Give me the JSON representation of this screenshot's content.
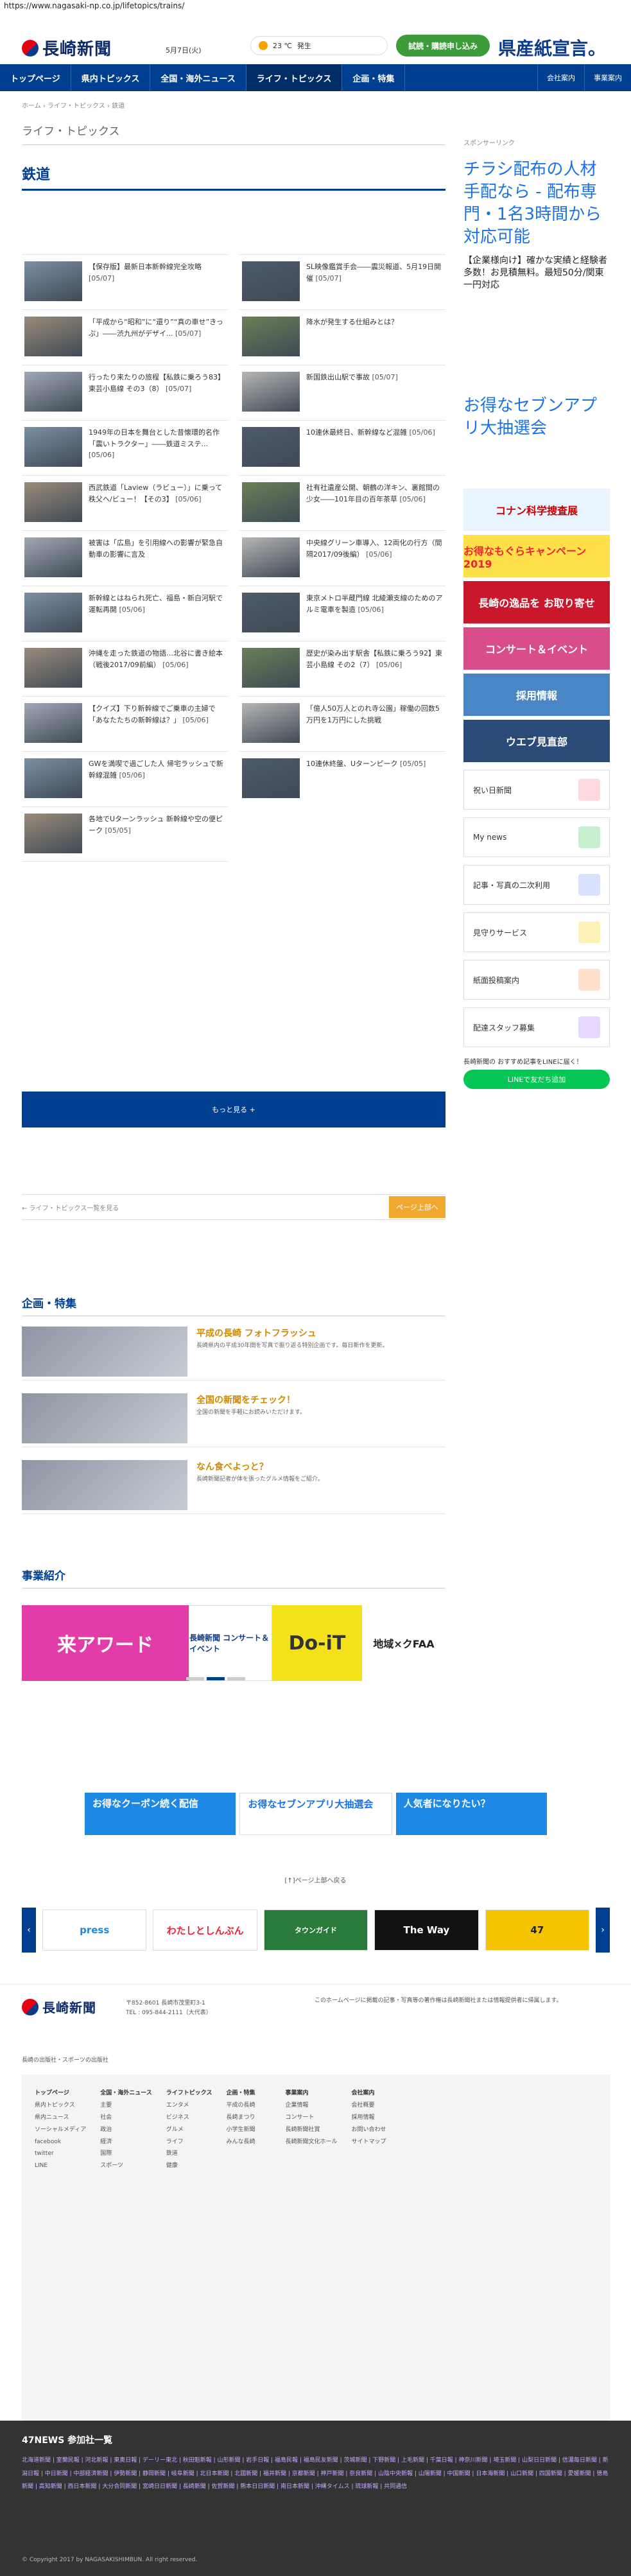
{
  "url": "https://www.nagasaki-np.co.jp/lifetopics/trains/",
  "header": {
    "logo_text": "長崎新聞",
    "date": "5月7日(火)",
    "weather_temp": "23 ℃",
    "weather_extra": "発生",
    "trial_button": "試読・購読申し込み",
    "slogan": "県産紙宣言。"
  },
  "nav": {
    "items": [
      "トップページ",
      "県内トピックス",
      "全国・海外ニュース",
      "ライフ・トピックス",
      "企画・特集"
    ],
    "right": [
      "会社案内",
      "事業案内"
    ]
  },
  "breadcrumb": "ホーム › ライフ・トピックス › 鉄道",
  "section_title": "ライフ・トピックス",
  "category_title": "鉄道",
  "articles": [
    {
      "title": "【保存版】最新日本新幹線完全攻略",
      "date": "[05/07]"
    },
    {
      "title": "SL映像鑑賞手会――震災報道、5月19日開催",
      "date": "[05/07]"
    },
    {
      "title": "「平成から“昭和”に“還り”“真の車せ”きっぷ」――渋九州がデザイ...",
      "date": "[05/07]"
    },
    {
      "title": "降水が発生する仕組みとは？",
      "date": ""
    },
    {
      "title": "行ったり来たりの旅程【私鉄に乗ろう83】東芸小島線 その3（8）",
      "date": "[05/07]"
    },
    {
      "title": "新国鉄出山駅で事故",
      "date": "[05/07]"
    },
    {
      "title": "1949年の日本を舞台とした昔懐環的名作「震いトラクター」――鉄道ミステ...",
      "date": "[05/06]"
    },
    {
      "title": "10連休最終日、新幹線など混雑",
      "date": "[05/06]"
    },
    {
      "title": "西武鉄道「Laview（ラビュー）」に乗って秩父へ/ビュー！【その3】",
      "date": "[05/06]"
    },
    {
      "title": "社有社遺産公開、朝鶴の洋キン、裏館間の少女――101年目の百年茶草",
      "date": "[05/06]"
    },
    {
      "title": "被害は「広島」を引用線への影響が緊急自動車の影響に言及",
      "date": ""
    },
    {
      "title": "中央線グリーン車導入、12両化の行方（間隔2017/09後編）",
      "date": "[05/06]"
    },
    {
      "title": "新幹線とはねられ死亡、福島・新白河駅で運転再開",
      "date": "[05/06]"
    },
    {
      "title": "東京メトロ半蔵門線 北綾瀬支線のためのアルミ電車を製造",
      "date": "[05/06]"
    },
    {
      "title": "沖縄を走った鉄道の物語…北谷に書き絵本（戦後2017/09前編）",
      "date": "[05/06]"
    },
    {
      "title": "歴史が染み出す駅舎【私鉄に乗ろう92】東芸小島線 その2（7）",
      "date": "[05/06]"
    },
    {
      "title": "【クイズ】下り新幹線でご乗車の主婦で「あなたたちの新幹線は？」",
      "date": "[05/06]"
    },
    {
      "title": "「億人50万人とのれ寺公園」稼働の回数5万円を1万円にした挑戦",
      "date": ""
    },
    {
      "title": "GWを満喫で過ごした人 帰宅ラッシュで新幹線混雑",
      "date": "[05/06]"
    },
    {
      "title": "10連休終盤、Uターンピーク",
      "date": "[05/05]"
    },
    {
      "title": "各地でUターンラッシュ 新幹線や空の便ピーク",
      "date": "[05/05]"
    }
  ],
  "more_button": "もっと見る +",
  "back_link": "← ライフ・トピックス一覧を見る",
  "top_button": "ページ上部へ",
  "features": {
    "title": "企画・特集",
    "items": [
      {
        "name": "平成の長崎 フォトフラッシュ",
        "desc": "長崎県内の平成30年間を写真で振り返る特別企画です。毎日新作を更新。"
      },
      {
        "name": "全国の新聞をチェック！",
        "desc": "全国の新聞を手軽にお読みいただけます。"
      },
      {
        "name": "なん食べよっと？",
        "desc": "長崎新聞記者が体を張ったグルメ情報をご紹介。"
      }
    ]
  },
  "business": {
    "title": "事業紹介",
    "banners": [
      "来アワード",
      "長崎新聞 コンサート＆イベント",
      "Do-iT",
      "地域×クFAA"
    ]
  },
  "sidebar": {
    "label": "スポンサーリンク",
    "ad_text": "チラシ配布の人材手配なら - 配布専門・1名3時間から対応可能",
    "ad_sub": "【企業様向け】確かな実績と経験者多数！お見積無料。最短50分/関東一円対応",
    "ad2_text": "お得なセブンアプリ大抽選会",
    "boxes": [
      "祝い日新聞",
      "My news",
      "記事・写真の二次利用",
      "見守りサービス",
      "紙面投稿案内",
      "配達スタッフ募集"
    ],
    "banners": [
      "コナン科学捜査展",
      "お得なもぐらキャンペーン 2019",
      "長崎の逸品を お取り寄せ",
      "コンサート＆イベント",
      "採用情報",
      "ウエブ見直部"
    ],
    "line_label": "長崎新聞の おすすめ記事をLINEに届く！",
    "line_button": "LINEで友だち追加"
  },
  "bottom_ads": [
    "お得なクーポン続く配信",
    "お得なセブンアプリ大抽選会",
    "人気者になりたい？"
  ],
  "to_top": "[↑]ページ上部へ戻る",
  "carousel": [
    "press",
    "わたしとしんぶん",
    "タウンガイド",
    "The Way",
    "47"
  ],
  "footer": {
    "logo_text": "長崎新聞",
    "addr1": "〒852-8601 長崎市茂里町3-1",
    "addr2": "TEL : 095-844-2111（大代表）",
    "sub": "長崎の出版社・スポーツの出版社",
    "note": "このホームページに掲載の記事・写真等の著作権は長崎新聞社または情報提供者に帰属します。",
    "cols": [
      {
        "h": "トップページ",
        "items": [
          "県内トピックス",
          "県内ニュース",
          "ソーシャルメディア",
          "facebook",
          "twitter",
          "LINE"
        ]
      },
      {
        "h": "全国・海外ニュース",
        "items": [
          "主要",
          "社会",
          "政治",
          "経済",
          "国際",
          "スポーツ"
        ]
      },
      {
        "h": "ライフトピックス",
        "items": [
          "エンタメ",
          "ビジネス",
          "グルメ",
          "ライフ",
          "鉄道",
          "健康"
        ]
      },
      {
        "h": "企画・特集",
        "items": [
          "平成の長崎",
          "長崎まつり",
          "小学生新聞",
          "みんな長崎"
        ]
      },
      {
        "h": "事業案内",
        "items": [
          "企業情報",
          "コンサート",
          "長崎新聞社賞",
          "長崎新聞文化ホール"
        ]
      },
      {
        "h": "会社案内",
        "items": [
          "会社概要",
          "採用情報",
          "お問い合わせ",
          "サイトマップ"
        ]
      }
    ]
  },
  "news47": {
    "title": "47NEWS 参加社一覧",
    "links": "北海道新聞 | 室蘭民報 | 河北新報 | 東奥日報 | デーリー東北 | 秋田魁新報 | 山形新聞 | 岩手日報 | 福島民報 | 福島民友新聞 | 茨城新聞 | 下野新聞 | 上毛新聞 | 千葉日報 | 神奈川新聞 | 埼玉新聞 | 山梨日日新聞 | 信濃毎日新聞 | 新潟日報 | 中日新聞 | 中部経済新聞 | 伊勢新聞 | 静岡新聞 | 岐阜新聞 | 北日本新聞 | 北國新聞 | 福井新聞 | 京都新聞 | 神戸新聞 | 奈良新聞 | 山陰中央新報 | 山陽新聞 | 中国新聞 | 日本海新聞 | 山口新聞 | 四国新聞 | 愛媛新聞 | 徳島新聞 | 高知新聞 | 西日本新聞 | 大分合同新聞 | 宮崎日日新聞 | 長崎新聞 | 佐賀新聞 | 熊本日日新聞 | 南日本新聞 | 沖縄タイムス | 琉球新報 | 共同通信",
    "copy": "© Copyright 2017 by NAGASAKISHIMBUN. All right reserved."
  }
}
